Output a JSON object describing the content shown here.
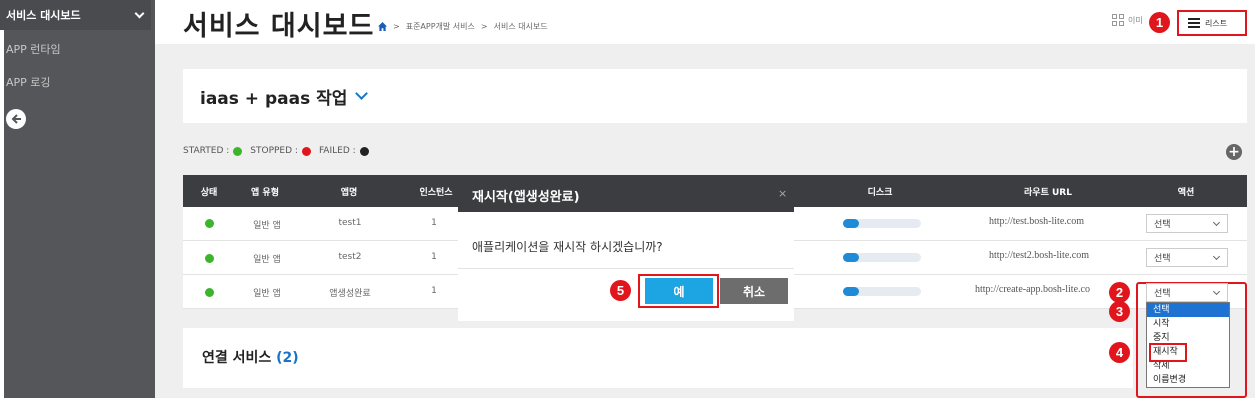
{
  "sidebar": {
    "header": "서비스 대시보드",
    "items": [
      "APP 런타임",
      "APP 로깅"
    ]
  },
  "header": {
    "title": "서비스 대시보드",
    "breadcrumb": [
      "표준APP개발 서비스",
      "서비스 대시보드"
    ],
    "view_image_label": "이미",
    "view_list_label": "리스트"
  },
  "org": {
    "title": "iaas + paas 작업"
  },
  "legend": {
    "started": "STARTED :",
    "stopped": "STOPPED :",
    "failed": "FAILED :",
    "colors": {
      "started": "#3cb52d",
      "stopped": "#e0161c",
      "failed": "#222222"
    }
  },
  "table": {
    "headers": [
      "상태",
      "앱 유형",
      "앱명",
      "인스턴스",
      "디스크",
      "라우트 URL",
      "액션"
    ],
    "rows": [
      {
        "type": "일반 앱",
        "name": "test1",
        "instances": "1",
        "url": "http://test.bosh-lite.com",
        "action": "선택"
      },
      {
        "type": "일반 앱",
        "name": "test2",
        "instances": "1",
        "url": "http://test2.bosh-lite.com",
        "action": "선택"
      },
      {
        "type": "일반 앱",
        "name": "앱생성완료",
        "instances": "1",
        "url": "http://create-app.bosh-lite.co",
        "action": "선택"
      }
    ]
  },
  "dropdown": {
    "options": [
      "선택",
      "시작",
      "중지",
      "재시작",
      "삭제",
      "이름변경"
    ],
    "selected": "선택"
  },
  "services": {
    "title": "연결 서비스",
    "count": "(2)"
  },
  "modal": {
    "title": "재시작(앱생성완료)",
    "close": "×",
    "message": "애플리케이션을 재시작 하시겠습니까?",
    "yes": "예",
    "no": "취소"
  },
  "annotations": [
    "1",
    "2",
    "3",
    "4",
    "5"
  ],
  "accent": "#e0161c"
}
